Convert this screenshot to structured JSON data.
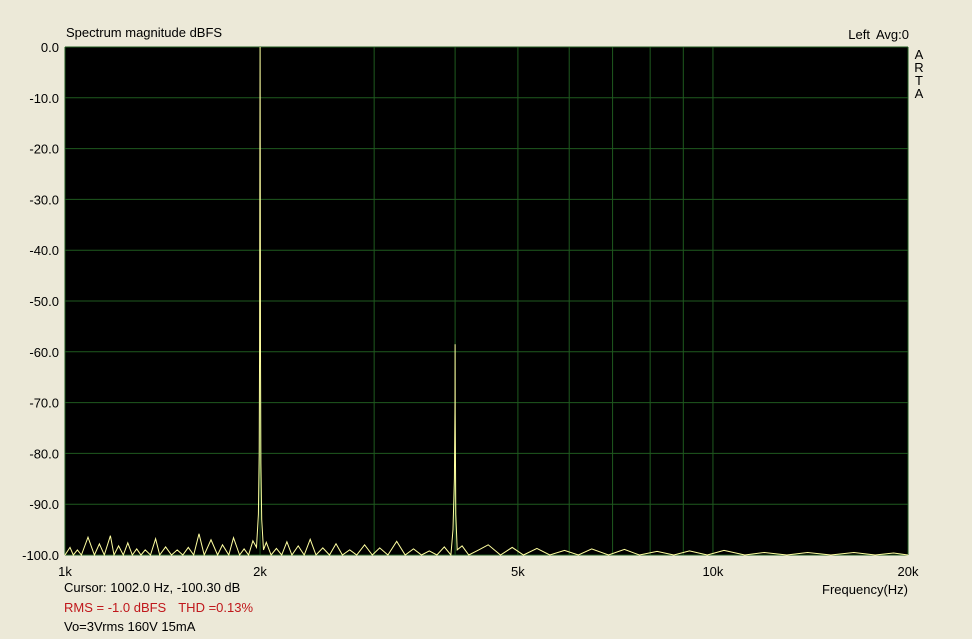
{
  "header": {
    "title": "Spectrum magnitude dBFS",
    "channel": "Left",
    "averages": "Avg:0",
    "brand_letters": [
      "A",
      "R",
      "T",
      "A"
    ]
  },
  "footer": {
    "cursor": "Cursor:  1002.0 Hz, -100.30 dB",
    "rms": "RMS =   -1.0 dBFS",
    "thd": "THD =0.13%",
    "note": "Vo=3Vrms 160V 15mA"
  },
  "colors": {
    "plot_background": "#000000",
    "grid": "#1f5a1f",
    "trace": "#ffffa0",
    "frame": "#ece9d8",
    "status_red": "#c0171b"
  },
  "chart_data": {
    "type": "line",
    "title": "Spectrum magnitude dBFS",
    "xlabel": "Frequency(Hz)",
    "ylabel": "",
    "x_scale": "log",
    "xlim": [
      1000,
      20000
    ],
    "ylim": [
      -100,
      0
    ],
    "x_ticks": [
      1000,
      2000,
      5000,
      10000,
      20000
    ],
    "x_tick_labels": [
      "1k",
      "2k",
      "5k",
      "10k",
      "20k"
    ],
    "x_minor_grid": [
      3000,
      4000,
      6000,
      7000,
      8000,
      9000
    ],
    "y_ticks": [
      0,
      -10,
      -20,
      -30,
      -40,
      -50,
      -60,
      -70,
      -80,
      -90,
      -100
    ],
    "y_tick_labels": [
      "0.0",
      "-10.0",
      "-20.0",
      "-30.0",
      "-40.0",
      "-50.0",
      "-60.0",
      "-70.0",
      "-80.0",
      "-90.0",
      "-100.0"
    ],
    "grid": true,
    "series": [
      {
        "x": [
          1000,
          1018,
          1030,
          1045,
          1060,
          1085,
          1110,
          1130,
          1150,
          1175,
          1190,
          1210,
          1230,
          1250,
          1270,
          1290,
          1310,
          1330,
          1355,
          1380,
          1400,
          1430,
          1460,
          1490,
          1520,
          1550,
          1580,
          1610,
          1640,
          1680,
          1720,
          1750,
          1790,
          1820,
          1860,
          1890,
          1920,
          1950,
          1975,
          1988,
          1994,
          1997,
          1999,
          2000,
          2001,
          2003,
          2006,
          2012,
          2025,
          2045,
          2080,
          2120,
          2160,
          2200,
          2240,
          2290,
          2340,
          2390,
          2440,
          2500,
          2560,
          2620,
          2680,
          2750,
          2820,
          2900,
          2980,
          3060,
          3150,
          3250,
          3350,
          3450,
          3550,
          3650,
          3750,
          3850,
          3940,
          3970,
          3990,
          3998,
          4000,
          4002,
          4010,
          4030,
          4100,
          4200,
          4350,
          4500,
          4700,
          4900,
          5100,
          5350,
          5600,
          5900,
          6200,
          6500,
          6900,
          7300,
          7700,
          8200,
          8700,
          9200,
          9800,
          10400,
          11200,
          12000,
          13000,
          14000,
          15200,
          16500,
          17800,
          19000,
          20000
        ],
        "y": [
          -100,
          -98.5,
          -100,
          -99,
          -100,
          -96.5,
          -100,
          -97.8,
          -100,
          -96.2,
          -100,
          -98.2,
          -100,
          -97.6,
          -100,
          -98.8,
          -100,
          -99,
          -100,
          -96.8,
          -100,
          -98.4,
          -100,
          -99,
          -100,
          -98.5,
          -100,
          -95.8,
          -100,
          -97,
          -100,
          -98,
          -100,
          -96.6,
          -100,
          -98.8,
          -100,
          -97.2,
          -98.5,
          -92,
          -80,
          -58,
          -20,
          0,
          -15,
          -60,
          -82,
          -93,
          -99,
          -97.5,
          -100,
          -98.7,
          -100,
          -97.4,
          -100,
          -98.2,
          -100,
          -96.9,
          -100,
          -98.6,
          -100,
          -97.8,
          -100,
          -99,
          -100,
          -98,
          -100,
          -98.6,
          -100,
          -97.3,
          -100,
          -98.8,
          -100,
          -99.2,
          -100,
          -98.4,
          -100,
          -95,
          -85,
          -70,
          -58.5,
          -72,
          -92,
          -99,
          -98.2,
          -100,
          -99,
          -98,
          -100,
          -98.5,
          -100,
          -98.7,
          -100,
          -99.1,
          -100,
          -98.8,
          -100,
          -98.9,
          -100,
          -99.3,
          -100,
          -99.2,
          -100,
          -99.1,
          -100,
          -99.5,
          -100,
          -99.5,
          -100,
          -99.5,
          -100,
          -99.6,
          -100
        ]
      }
    ]
  }
}
